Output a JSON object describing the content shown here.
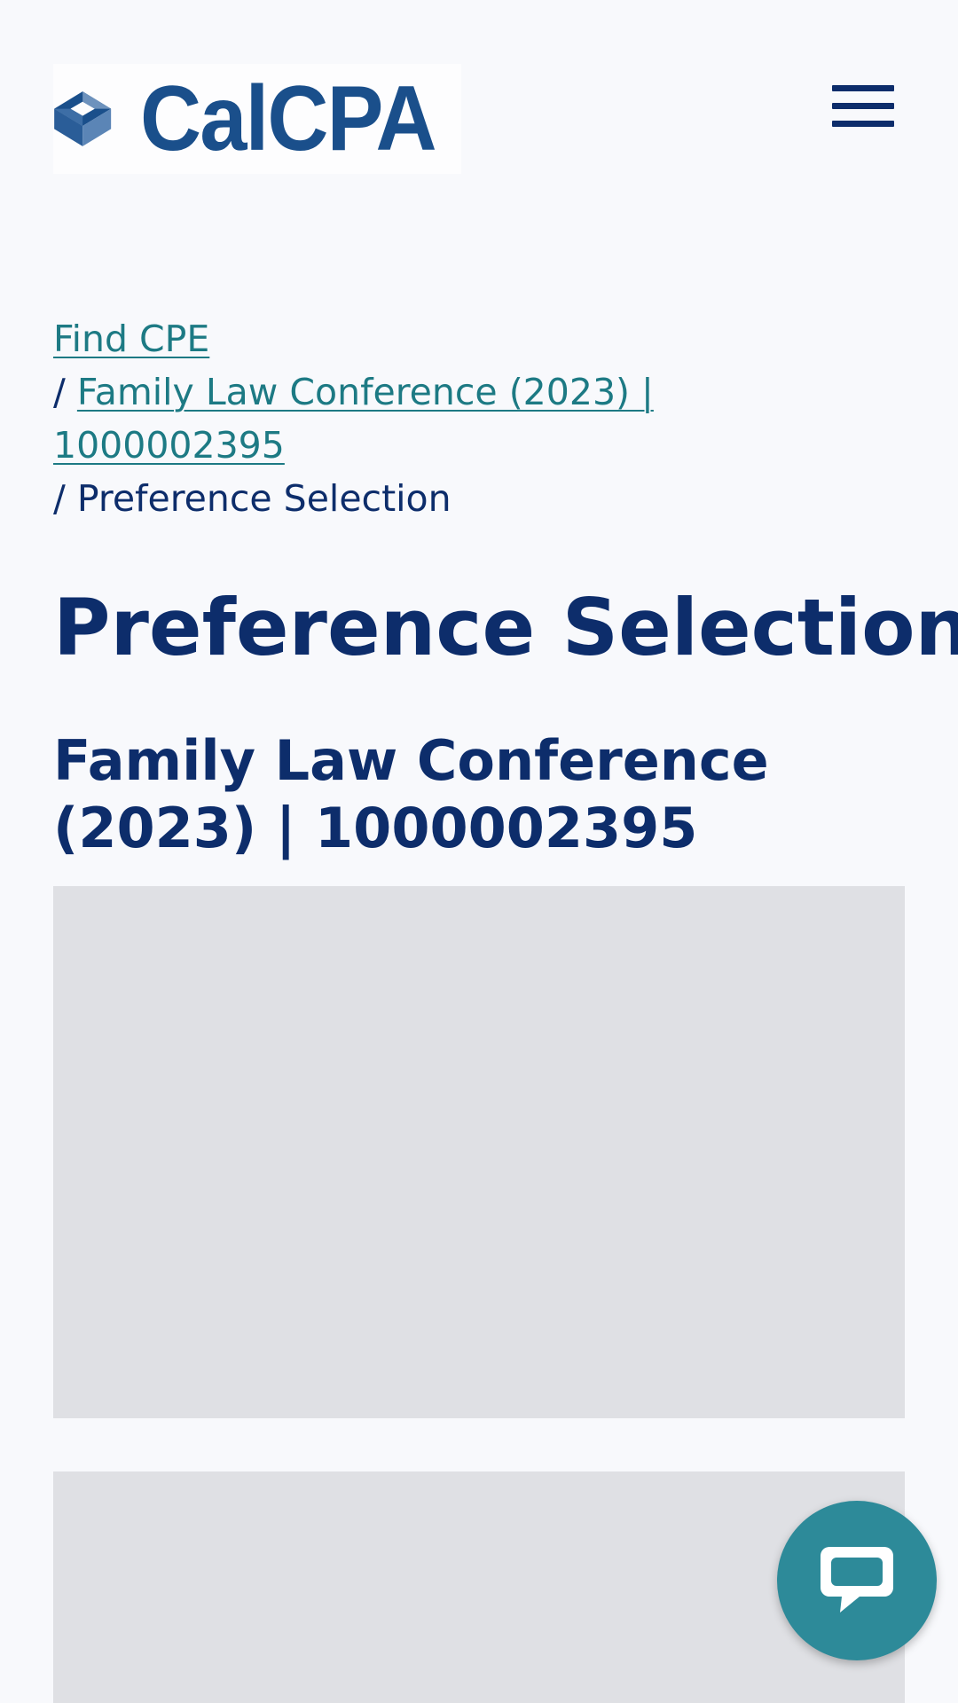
{
  "brand": {
    "name": "CalCPA",
    "color_primary": "#1a4f8b",
    "color_navy": "#0d2d6b",
    "color_link": "#1d7a84"
  },
  "header": {
    "logo_icon": "calcpa-cube-logo",
    "menu_icon": "hamburger-menu-icon"
  },
  "breadcrumb": {
    "items": [
      {
        "label": "Find CPE",
        "link": true
      },
      {
        "label": "Family Law Conference (2023) | 1000002395",
        "link": true
      },
      {
        "label": "Preference Selection",
        "link": false
      }
    ],
    "separator": "/"
  },
  "main": {
    "title": "Preference Selection",
    "event_title": "Family Law Conference (2023) | 1000002395"
  },
  "chat": {
    "icon": "chat-bubble-icon",
    "color": "#2d8a99"
  }
}
